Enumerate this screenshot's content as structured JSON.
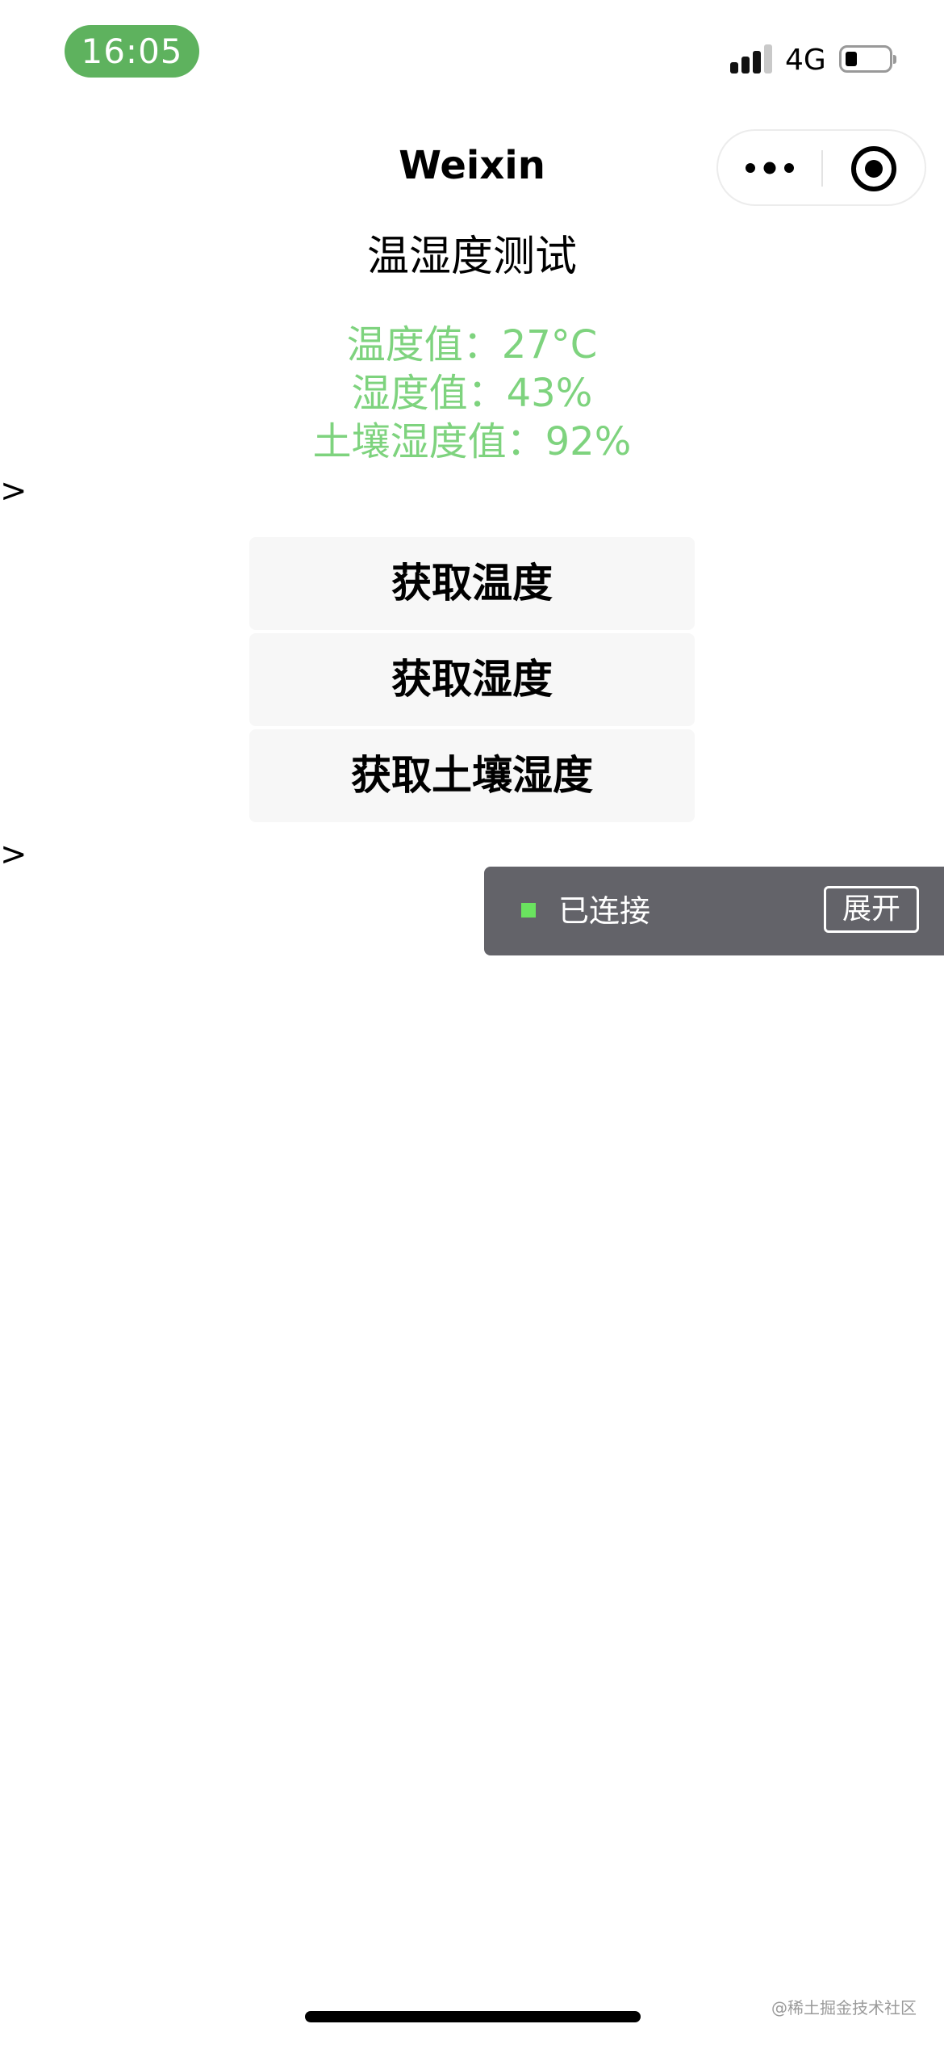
{
  "status_bar": {
    "time": "16:05",
    "network": "4G",
    "signal_icon": "signal-bars-icon",
    "battery_icon": "battery-icon",
    "status_pill_color": "#5eb25e"
  },
  "nav": {
    "title": "Weixin",
    "more_icon": "more-dots-icon",
    "close_icon": "target-close-icon"
  },
  "page": {
    "heading": "温湿度测试",
    "readings": [
      "温度值：27°C",
      "湿度值：43%",
      "土壤湿度值：92%"
    ],
    "reading_color": "#7ed37e",
    "markers": [
      ">",
      ">"
    ]
  },
  "buttons": {
    "get_temperature": "获取温度",
    "get_humidity": "获取湿度",
    "get_soil_humidity": "获取土壤湿度"
  },
  "connection": {
    "status": "已连接",
    "expand_label": "展开",
    "indicator_color": "#6ae35f"
  },
  "watermark": "@稀土掘金技术社区"
}
